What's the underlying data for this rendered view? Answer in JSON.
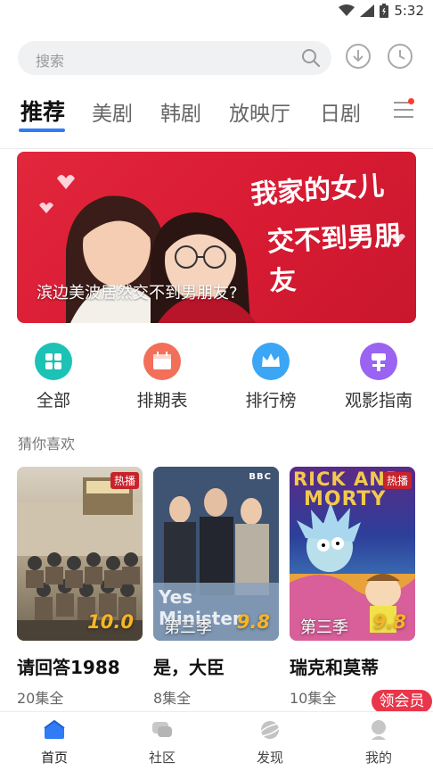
{
  "status_bar": {
    "time": "5:32",
    "icons": [
      "wifi-icon",
      "signal-icon",
      "battery-icon"
    ]
  },
  "search": {
    "placeholder": "搜索"
  },
  "header_actions": [
    "download-icon",
    "history-icon"
  ],
  "tabs": [
    {
      "label": "推荐",
      "active": true
    },
    {
      "label": "美剧"
    },
    {
      "label": "韩剧"
    },
    {
      "label": "放映厅"
    },
    {
      "label": "日剧"
    }
  ],
  "banner": {
    "caption": "滨边美波居然交不到男朋友?",
    "art_text_line1": "我家的女儿",
    "art_text_line2": "交不到男朋友"
  },
  "quick_entries": [
    {
      "label": "全部",
      "icon": "grid-icon",
      "color": "#1cc2b5"
    },
    {
      "label": "排期表",
      "icon": "calendar-icon",
      "color": "#f26f5a"
    },
    {
      "label": "排行榜",
      "icon": "crown-icon",
      "color": "#3aa6f5"
    },
    {
      "label": "观影指南",
      "icon": "guide-icon",
      "color": "#9a63f2"
    }
  ],
  "section_title": "猜你喜欢",
  "cards": [
    {
      "title": "请回答1988",
      "episodes": "20集全",
      "badge": "热播",
      "score": "10.0",
      "season": ""
    },
    {
      "title": "是，大臣",
      "episodes": "8集全",
      "badge": "",
      "score": "9.8",
      "season": "第三季",
      "poster_text": "Yes Minister",
      "poster_logo": "BBC"
    },
    {
      "title": "瑞克和莫蒂",
      "episodes": "10集全",
      "badge": "热播",
      "score": "9.8",
      "season": "第三季",
      "poster_text_1": "RICK AND",
      "poster_text_2": "MORTY"
    }
  ],
  "vip_button": "领会员",
  "bottom_nav": [
    {
      "label": "首页",
      "icon": "home-icon",
      "active": true
    },
    {
      "label": "社区",
      "icon": "community-icon"
    },
    {
      "label": "发现",
      "icon": "discover-icon"
    },
    {
      "label": "我的",
      "icon": "profile-icon"
    }
  ],
  "colors": {
    "accent": "#2f7cf6",
    "score": "#f7b524",
    "badge": "#c8232c",
    "vip": "#e8364a"
  }
}
